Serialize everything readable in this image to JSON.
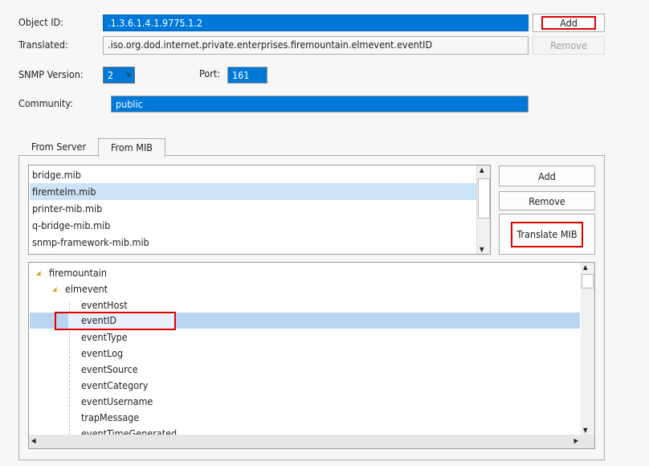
{
  "form": {
    "object_id_label": "Object ID:",
    "object_id_value": ".1.3.6.1.4.1.9775.1.2",
    "translated_label": "Translated:",
    "translated_value": ".iso.org.dod.internet.private.enterprises.firemountain.elmevent.eventID",
    "add_label": "Add",
    "remove_label": "Remove",
    "snmp_version_label": "SNMP Version:",
    "snmp_version_value": "2",
    "port_label": "Port:",
    "port_value": "161",
    "community_label": "Community:",
    "community_value": "public"
  },
  "tabs": [
    {
      "label": "From Server"
    },
    {
      "label": "From MIB",
      "selected": true
    }
  ],
  "mib": {
    "files": [
      "bridge.mib",
      "firemtelm.mib",
      "printer-mib.mib",
      "q-bridge-mib.mib",
      "snmp-framework-mib.mib"
    ],
    "selected_index": 1,
    "add_label": "Add",
    "remove_label": "Remove",
    "translate_label": "Translate MIB"
  },
  "tree": {
    "root": "firemountain",
    "child": "elmevent",
    "leaves": [
      "eventHost",
      "eventID",
      "eventType",
      "eventLog",
      "eventSource",
      "eventCategory",
      "eventUsername",
      "trapMessage",
      "eventTimeGenerated"
    ],
    "selected": "eventID"
  },
  "colors": {
    "accent": "#0078d7",
    "highlight": "#e00000",
    "selection": "#cce4f7"
  }
}
